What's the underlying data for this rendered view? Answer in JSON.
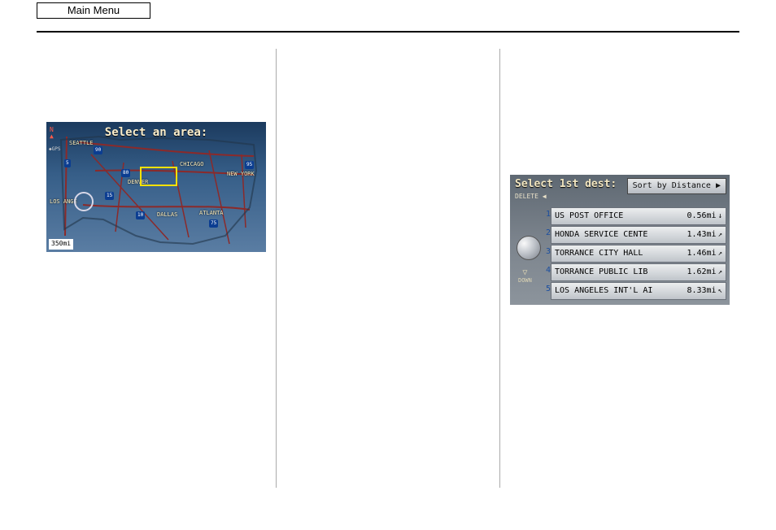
{
  "header": {
    "main_menu": "Main Menu"
  },
  "map": {
    "title": "Select an area:",
    "compass": "N",
    "gps": "◆GPS",
    "scale": "350mi",
    "labels": {
      "seattle": "SEATTLE",
      "denver": "DENVER",
      "chicago": "CHICAGO",
      "newyork": "NEW YORK",
      "losangeles": "LOS ANGE",
      "dallas": "DALLAS",
      "atlanta": "ATLANTA"
    },
    "shields": [
      "5",
      "90",
      "80",
      "15",
      "10",
      "75",
      "95"
    ]
  },
  "dest": {
    "header": "Select 1st dest:",
    "delete": "DELETE ◀",
    "sort": "Sort by Distance ▶",
    "down": "DOWN",
    "rows": [
      {
        "idx": "1",
        "name": "US POST OFFICE",
        "dist": "0.56mi",
        "arrow": "↓"
      },
      {
        "idx": "2",
        "name": "HONDA SERVICE CENTE",
        "dist": "1.43mi",
        "arrow": "↗"
      },
      {
        "idx": "3",
        "name": "TORRANCE CITY HALL",
        "dist": "1.46mi",
        "arrow": "↗"
      },
      {
        "idx": "4",
        "name": "TORRANCE PUBLIC LIB",
        "dist": "1.62mi",
        "arrow": "↗"
      },
      {
        "idx": "5",
        "name": "LOS ANGELES INT'L AI",
        "dist": "8.33mi",
        "arrow": "↖"
      }
    ]
  }
}
